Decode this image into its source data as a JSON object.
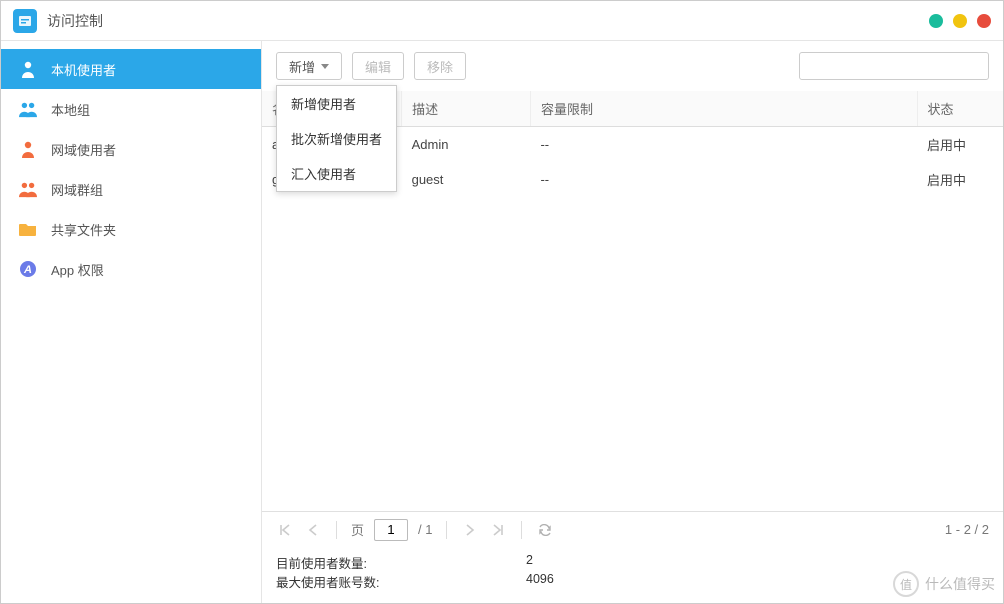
{
  "window": {
    "title": "访问控制"
  },
  "sidebar": {
    "items": [
      {
        "label": "本机使用者",
        "icon": "person-icon",
        "color": "#ffffff"
      },
      {
        "label": "本地组",
        "icon": "group-icon",
        "color": "#2ba7e8"
      },
      {
        "label": "网域使用者",
        "icon": "person-icon",
        "color": "#f26c3e"
      },
      {
        "label": "网域群组",
        "icon": "group-icon",
        "color": "#f26c3e"
      },
      {
        "label": "共享文件夹",
        "icon": "folder-icon",
        "color": "#f7b23e"
      },
      {
        "label": "App 权限",
        "icon": "app-icon",
        "color": "#6b7be8"
      }
    ]
  },
  "toolbar": {
    "add": "新增",
    "edit": "编辑",
    "remove": "移除",
    "search_placeholder": ""
  },
  "dropdown": {
    "items": [
      {
        "label": "新增使用者"
      },
      {
        "label": "批次新增使用者"
      },
      {
        "label": "汇入使用者"
      }
    ]
  },
  "table": {
    "headers": {
      "name": "名称",
      "desc": "描述",
      "quota": "容量限制",
      "status": "状态"
    },
    "rows": [
      {
        "name": "admin",
        "desc": "Admin",
        "quota": "--",
        "status": "启用中"
      },
      {
        "name": "guest",
        "desc": "guest",
        "quota": "--",
        "status": "启用中"
      }
    ]
  },
  "pager": {
    "page_label": "页",
    "page_value": "1",
    "total_pages": "/ 1",
    "range": "1 - 2 / 2"
  },
  "footer": {
    "current_users_label": "目前使用者数量:",
    "current_users_value": "2",
    "max_users_label": "最大使用者账号数:",
    "max_users_value": "4096"
  },
  "watermark": {
    "badge": "值",
    "text": "什么值得买"
  }
}
